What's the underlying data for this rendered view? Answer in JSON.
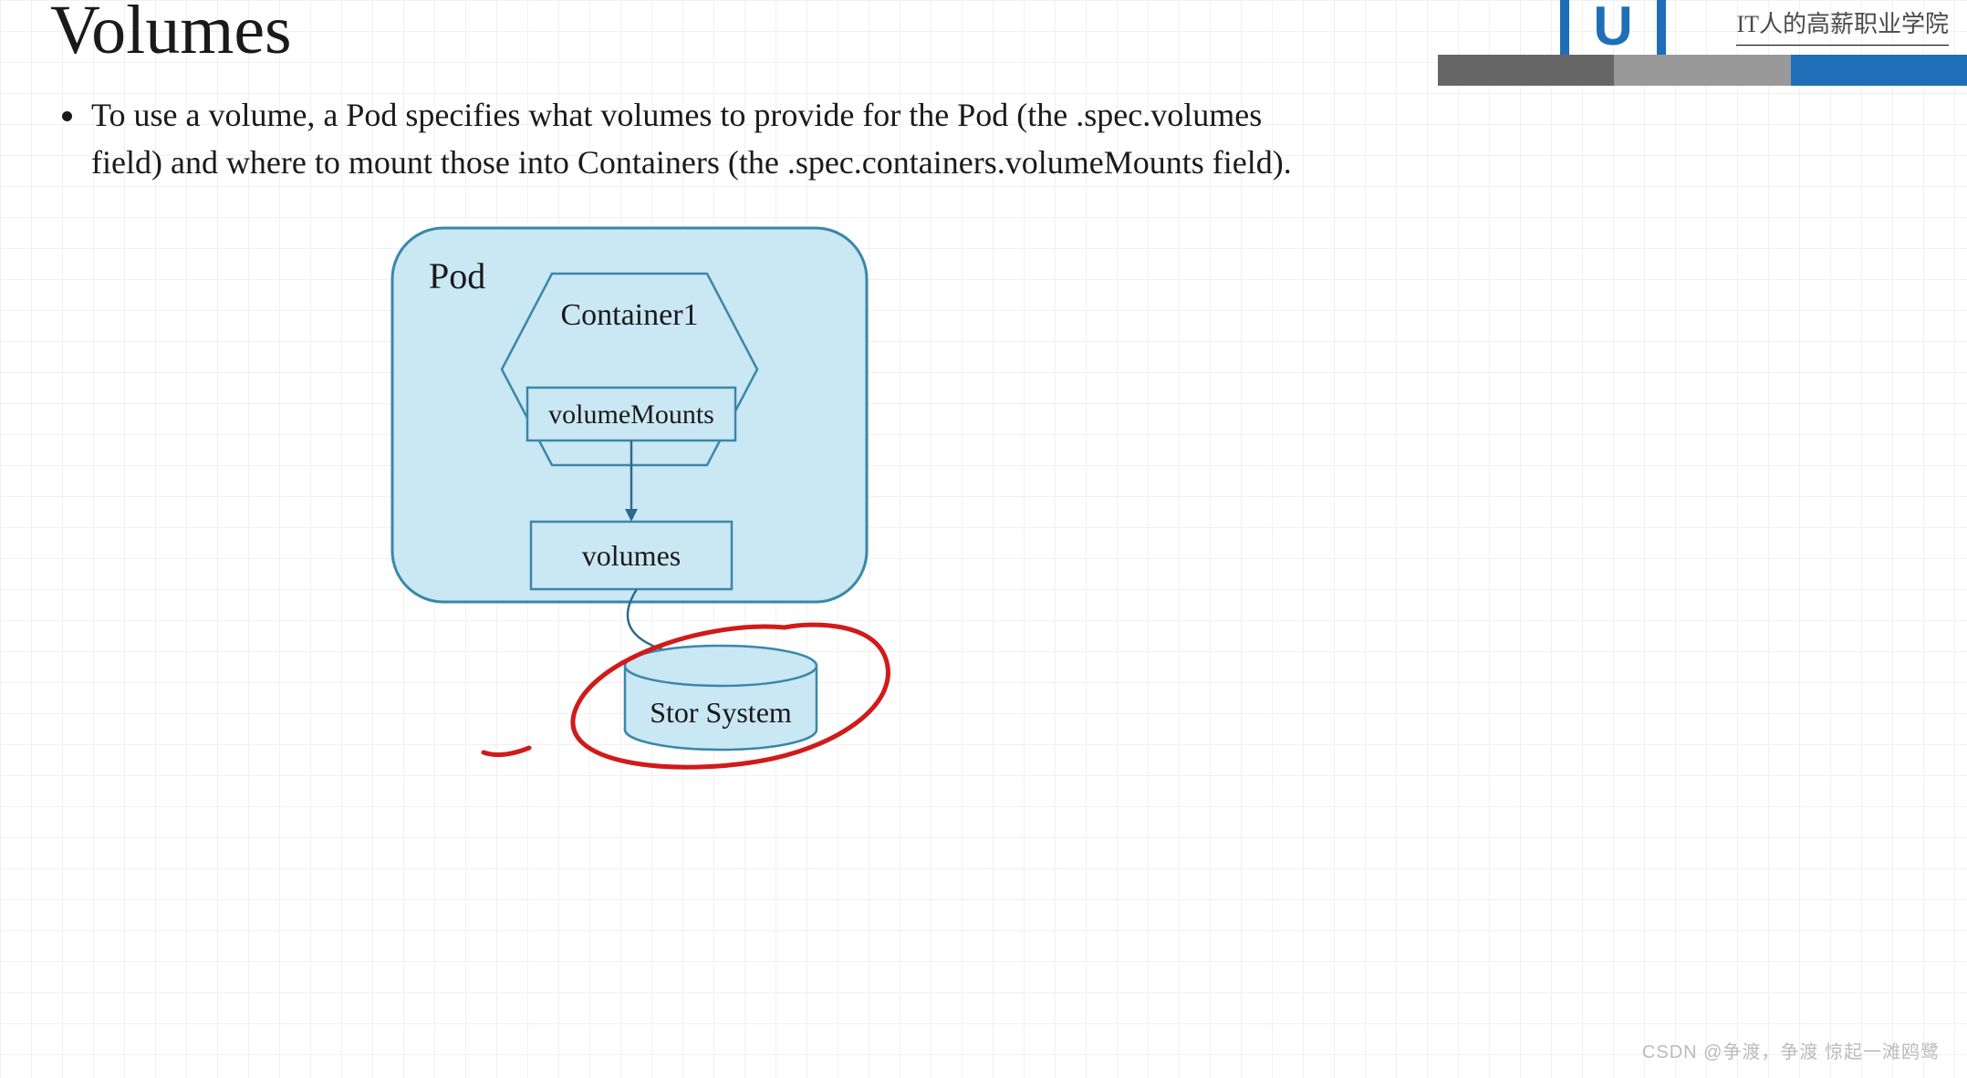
{
  "title": "Volumes",
  "bullet": "To use a volume, a Pod specifies what volumes to provide for the Pod (the .spec.volumes field) and where to mount those into Containers (the .spec.containers.volumeMounts field).",
  "diagram": {
    "pod_label": "Pod",
    "container_label": "Container1",
    "volume_mounts_label": "volumeMounts",
    "volumes_label": "volumes",
    "storage_label": "Stor System"
  },
  "branding": {
    "logo_letter": "U",
    "tagline": "IT人的高薪职业学院"
  },
  "watermark": "CSDN @争渡，争渡 惊起一滩鸥鹭",
  "colors": {
    "box_fill": "#cae7f4",
    "box_stroke": "#3a87a8",
    "ink": "#2c6b88",
    "annotation": "#d11a1a",
    "brand": "#1e6fb8"
  }
}
